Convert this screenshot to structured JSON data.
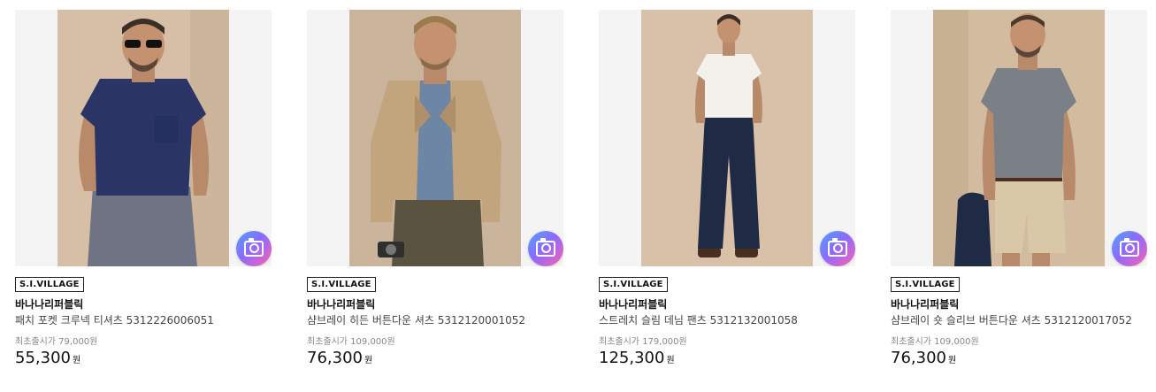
{
  "colors": {
    "lens_gradient": [
      "#4fa3ff",
      "#8a6cff",
      "#ff5fb0"
    ],
    "backdrop": "#d8c2aa"
  },
  "products": [
    {
      "badge": "S.I.VILLAGE",
      "brand": "바나나리퍼블릭",
      "name": "패치 포켓 크루넥 티셔츠 5312226006051",
      "original_price": "최초출시가 79,000원",
      "price": "55,300",
      "currency": "원",
      "icon": "camera-lens-icon"
    },
    {
      "badge": "S.I.VILLAGE",
      "brand": "바나나리퍼블릭",
      "name": "샴브레이 히든 버튼다운 셔츠 5312120001052",
      "original_price": "최초출시가 109,000원",
      "price": "76,300",
      "currency": "원",
      "icon": "camera-lens-icon"
    },
    {
      "badge": "S.I.VILLAGE",
      "brand": "바나나리퍼블릭",
      "name": "스트레치 슬림 데님 팬츠 5312132001058",
      "original_price": "최초출시가 179,000원",
      "price": "125,300",
      "currency": "원",
      "icon": "camera-lens-icon"
    },
    {
      "badge": "S.I.VILLAGE",
      "brand": "바나나리퍼블릭",
      "name": "샴브레이 숏 슬리브 버튼다운 셔츠 5312120017052",
      "original_price": "최초출시가 109,000원",
      "price": "76,300",
      "currency": "원",
      "icon": "camera-lens-icon"
    }
  ]
}
